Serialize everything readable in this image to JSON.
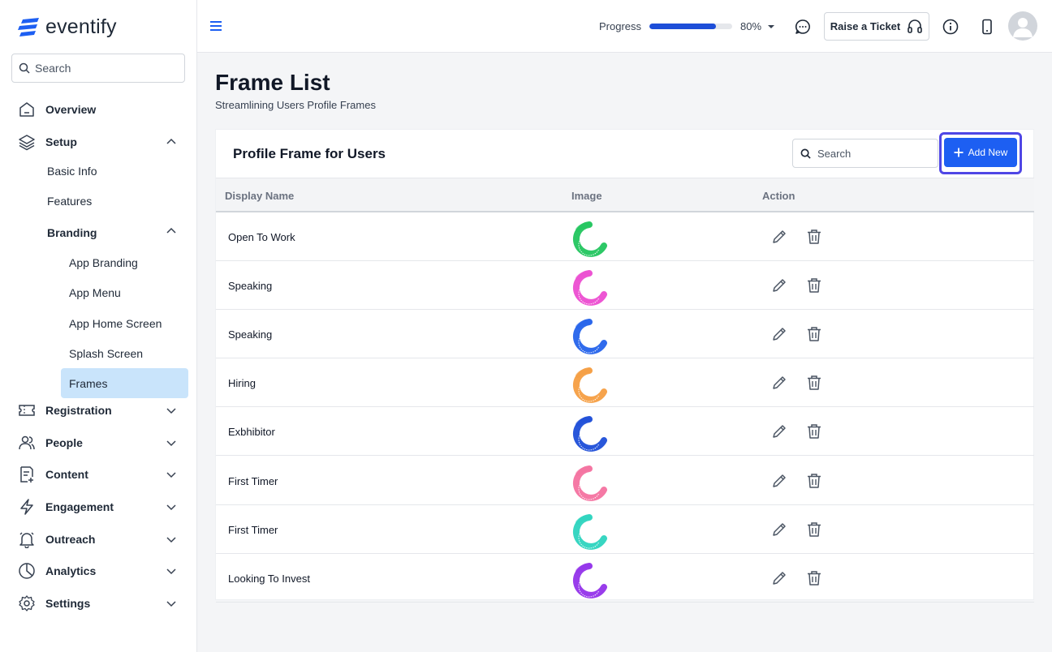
{
  "brand": {
    "name": "eventify",
    "accent": "#1d5ff2"
  },
  "sidebar": {
    "search_placeholder": "Search",
    "items": [
      {
        "label": "Overview",
        "icon": "home-icon"
      },
      {
        "label": "Setup",
        "icon": "layers-icon",
        "expanded": true
      },
      {
        "label": "Registration",
        "icon": "ticket-icon"
      },
      {
        "label": "People",
        "icon": "people-icon"
      },
      {
        "label": "Content",
        "icon": "document-plus-icon"
      },
      {
        "label": "Engagement",
        "icon": "lightning-icon"
      },
      {
        "label": "Outreach",
        "icon": "bell-icon"
      },
      {
        "label": "Analytics",
        "icon": "pie-chart-icon"
      },
      {
        "label": "Settings",
        "icon": "gear-icon"
      }
    ],
    "setup_children": [
      "Basic Info",
      "Features",
      "Branding"
    ],
    "branding_children": [
      "App Branding",
      "App Menu",
      "App Home Screen",
      "Splash Screen",
      "Frames"
    ],
    "active_item": "Frames"
  },
  "topbar": {
    "progress_label": "Progress",
    "progress_value": 0.8,
    "progress_text": "80%",
    "ticket_label": "Raise a Ticket"
  },
  "main": {
    "title": "Frame List",
    "subtitle": "Streamlining Users Profile Frames",
    "card_title": "Profile Frame for Users",
    "search_placeholder": "Search",
    "add_label": "Add New",
    "columns": [
      "Display Name",
      "Image",
      "Action"
    ],
    "rows": [
      {
        "name": "Open To Work",
        "frame_color": "#22c55e"
      },
      {
        "name": "Speaking",
        "frame_color": "#ec4dd1"
      },
      {
        "name": "Speaking",
        "frame_color": "#2563eb"
      },
      {
        "name": "Hiring",
        "frame_color": "#f59e42"
      },
      {
        "name": "Exbhibitor",
        "frame_color": "#1d4ed8"
      },
      {
        "name": "First Timer",
        "frame_color": "#f472a0"
      },
      {
        "name": "First Timer",
        "frame_color": "#2dd4bf"
      },
      {
        "name": "Looking To Invest",
        "frame_color": "#9333ea"
      }
    ]
  }
}
